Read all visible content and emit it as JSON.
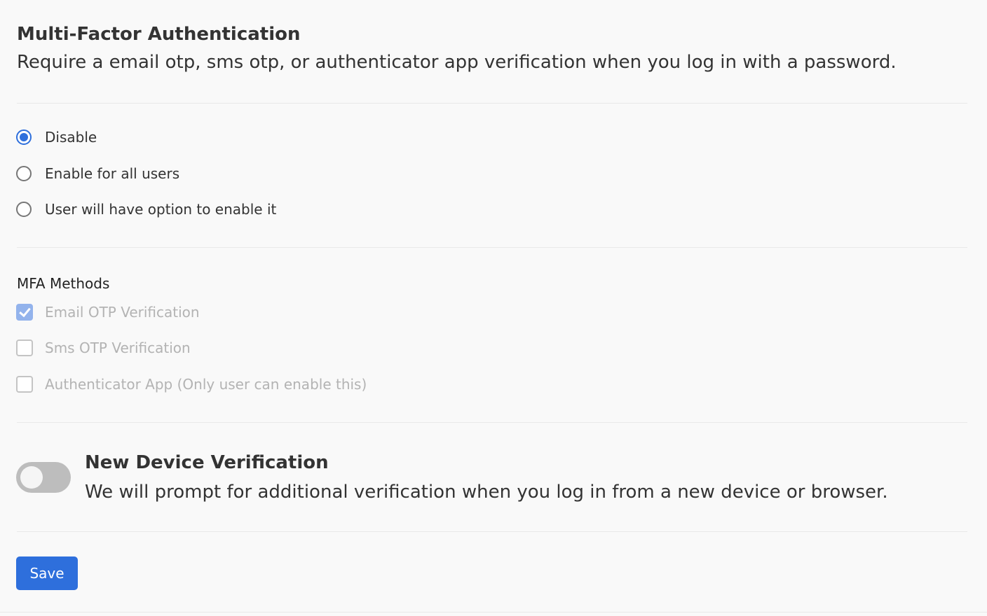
{
  "mfa": {
    "title": "Multi-Factor Authentication",
    "description": "Require a email otp, sms otp, or authenticator app verification when you log in with a password.",
    "options": [
      {
        "label": "Disable",
        "selected": true
      },
      {
        "label": "Enable for all users",
        "selected": false
      },
      {
        "label": "User will have option to enable it",
        "selected": false
      }
    ]
  },
  "methods": {
    "heading": "MFA Methods",
    "items": [
      {
        "label": "Email OTP Verification",
        "checked": true,
        "disabled": true
      },
      {
        "label": "Sms OTP Verification",
        "checked": false,
        "disabled": true
      },
      {
        "label": "Authenticator App (Only user can enable this)",
        "checked": false,
        "disabled": true
      }
    ]
  },
  "new_device": {
    "title": "New Device Verification",
    "description": "We will prompt for additional verification when you log in from a new device or browser.",
    "enabled": false
  },
  "actions": {
    "save_label": "Save"
  },
  "colors": {
    "accent": "#2e6fdc",
    "disabled_check": "#93b3ec",
    "toggle_off": "#bdbdbd"
  }
}
